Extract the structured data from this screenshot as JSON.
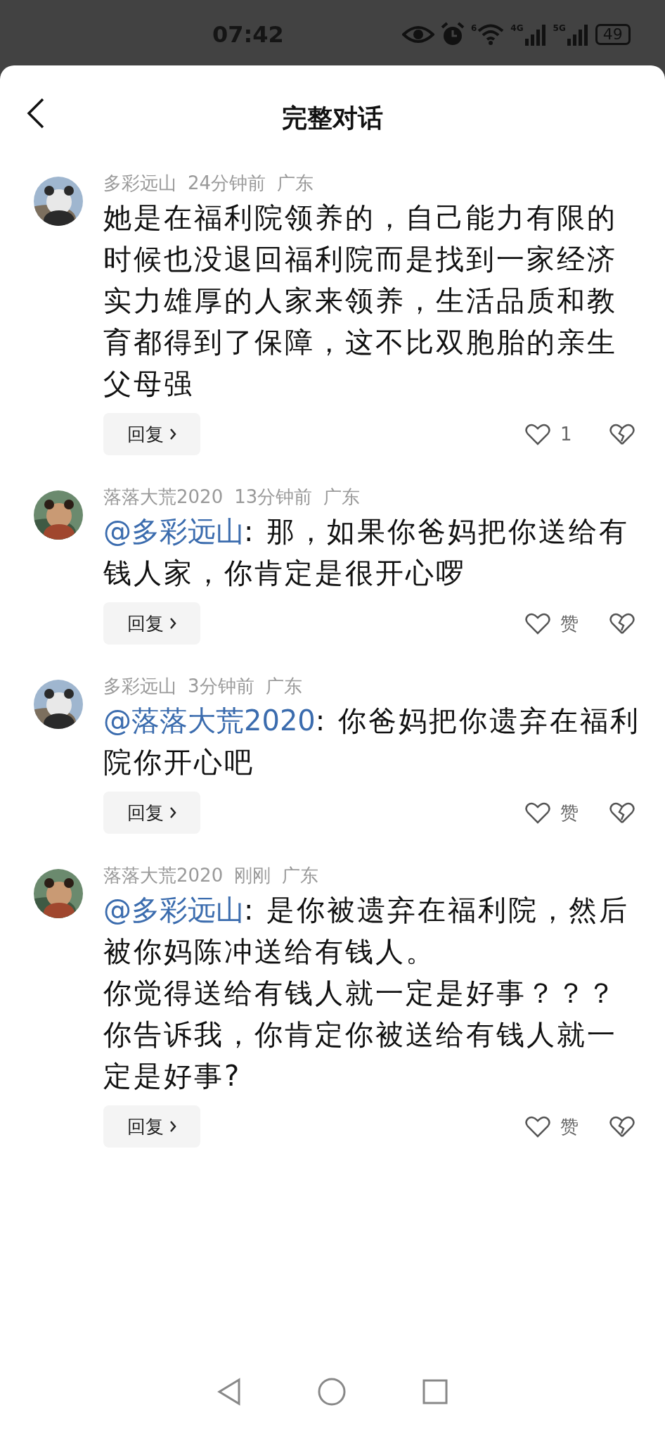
{
  "status_bar": {
    "time": "07:42",
    "wifi_label": "6",
    "signal_1_label": "4G",
    "signal_2_label": "5G",
    "battery": "49"
  },
  "header": {
    "title": "完整对话"
  },
  "comments": [
    {
      "author": "多彩远山",
      "time": "24分钟前",
      "location": "广东",
      "lines": [
        "她是在福利院领养的，自己能力有限的时候也没退回福利院而是找到一家经济实力雄厚的人家来领养，生活品质和教育都得到了保障，这不比双胞胎的亲生父母强"
      ],
      "reply": "回复",
      "likes": "1"
    },
    {
      "author": "落落大荒2020",
      "time": "13分钟前",
      "location": "广东",
      "mention": "@多彩远山",
      "lines": [
        ": 那，如果你爸妈把你送给有钱人家，你肯定是很开心啰"
      ],
      "reply": "回复",
      "likes": "赞"
    },
    {
      "author": "多彩远山",
      "time": "3分钟前",
      "location": "广东",
      "mention": "@落落大荒2020",
      "lines": [
        ": 你爸妈把你遗弃在福利院你开心吧"
      ],
      "reply": "回复",
      "likes": "赞"
    },
    {
      "author": "落落大荒2020",
      "time": "刚刚",
      "location": "广东",
      "mention": "@多彩远山",
      "lines": [
        ": 是你被遗弃在福利院，然后被你妈陈冲送给有钱人。",
        "你觉得送给有钱人就一定是好事？？？",
        "你告诉我，你肯定你被送给有钱人就一定是好事?"
      ],
      "reply": "回复",
      "likes": "赞"
    }
  ]
}
